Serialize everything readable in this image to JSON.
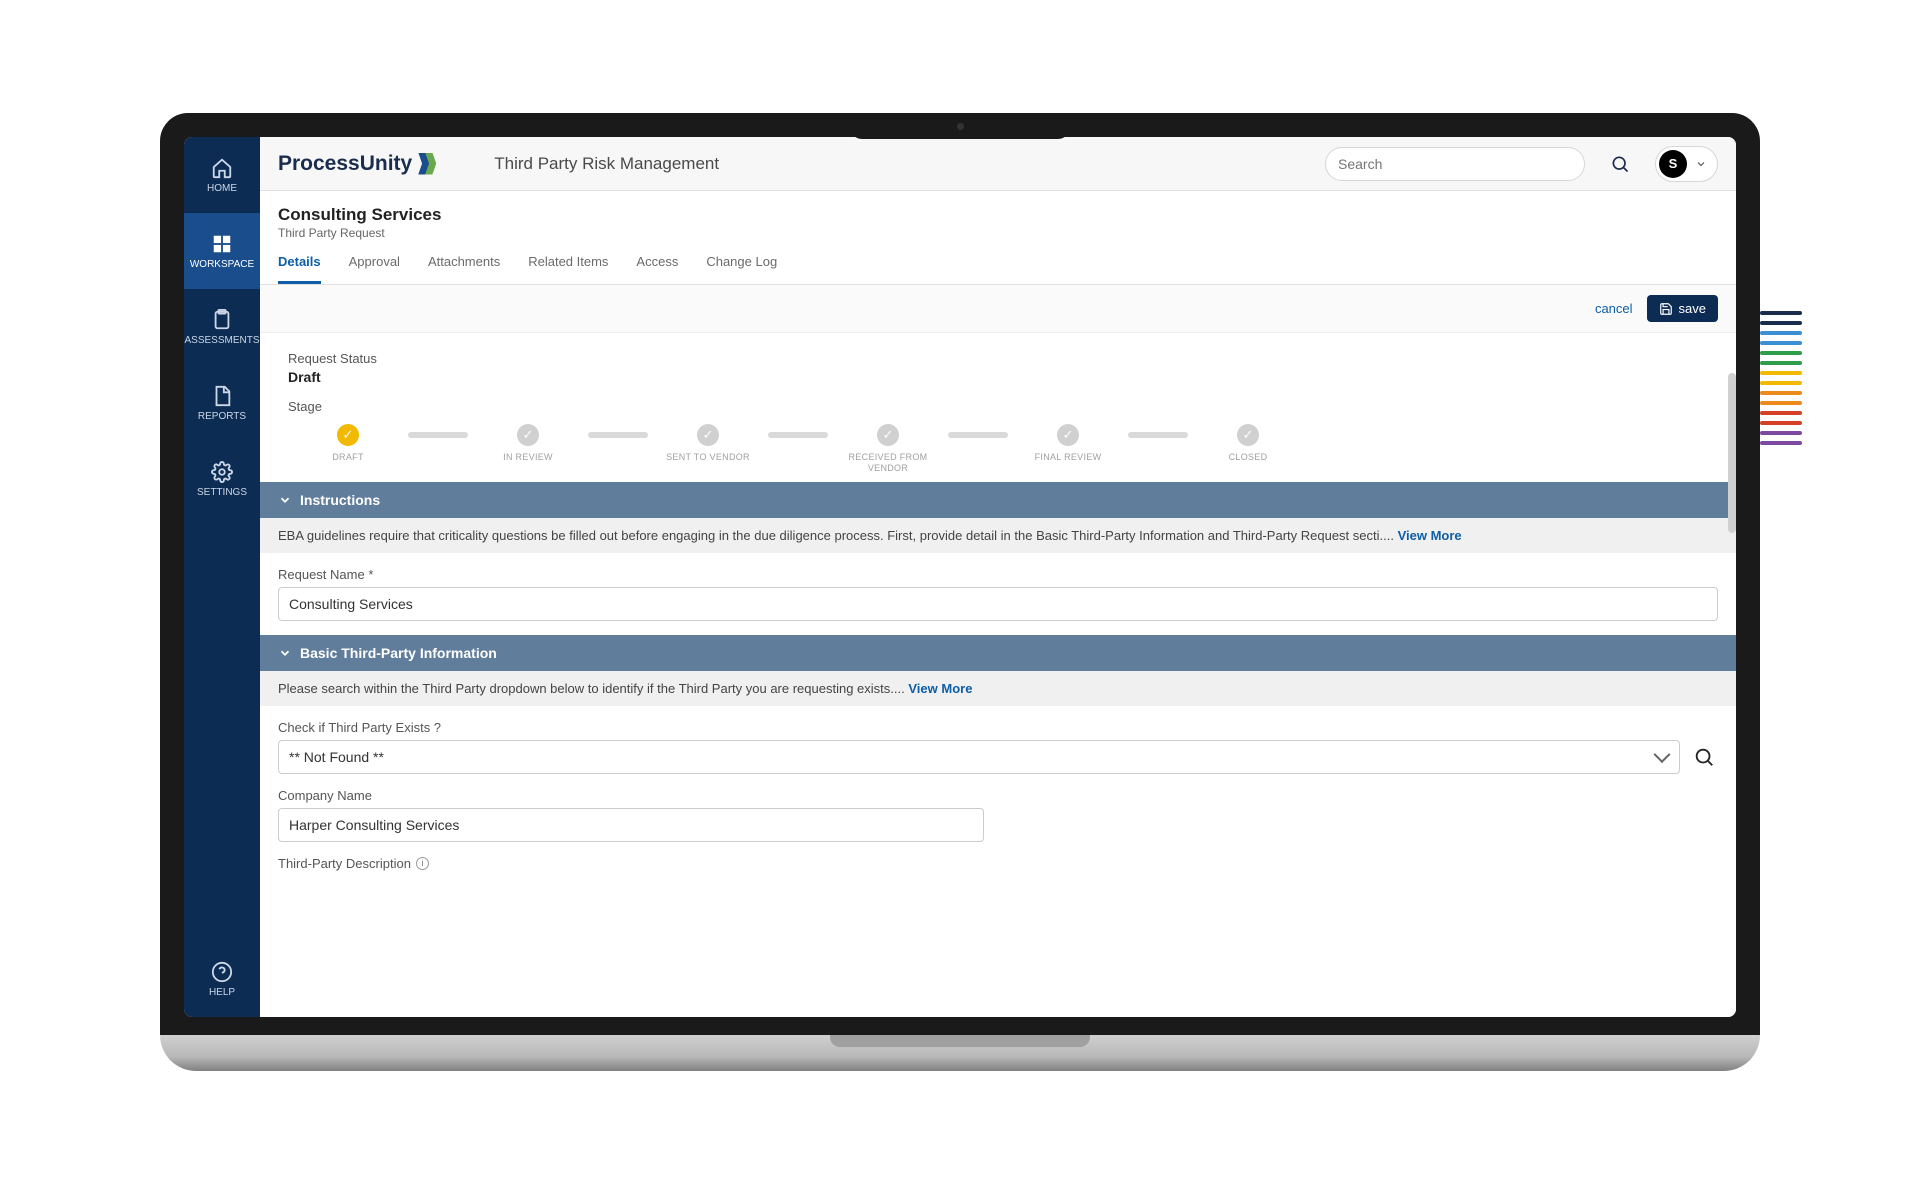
{
  "brand": {
    "name": "ProcessUnity"
  },
  "appTitle": "Third Party Risk Management",
  "search": {
    "placeholder": "Search"
  },
  "user": {
    "initial": "S"
  },
  "sidebar": {
    "items": [
      {
        "label": "HOME"
      },
      {
        "label": "WORKSPACE"
      },
      {
        "label": "ASSESSMENTS"
      },
      {
        "label": "REPORTS"
      },
      {
        "label": "SETTINGS"
      },
      {
        "label": "HELP"
      }
    ]
  },
  "page": {
    "title": "Consulting Services",
    "subtitle": "Third Party Request",
    "tabs": [
      "Details",
      "Approval",
      "Attachments",
      "Related Items",
      "Access",
      "Change Log"
    ],
    "activeTab": 0
  },
  "actions": {
    "cancel": "cancel",
    "save": "save"
  },
  "status": {
    "label": "Request Status",
    "value": "Draft",
    "stageLabel": "Stage",
    "stages": [
      "DRAFT",
      "IN REVIEW",
      "SENT TO VENDOR",
      "RECEIVED FROM VENDOR",
      "FINAL REVIEW",
      "CLOSED"
    ],
    "activeStage": 0
  },
  "sections": {
    "instructions": {
      "title": "Instructions",
      "hint": "EBA guidelines require that criticality questions be filled out before engaging in the due diligence process. First, provide detail in the Basic Third-Party Information and Third-Party Request secti....",
      "viewMore": "View More",
      "requestNameLabel": "Request Name *",
      "requestNameValue": "Consulting Services"
    },
    "basic": {
      "title": "Basic Third-Party Information",
      "hint": "Please search within the Third Party dropdown below to identify if the Third Party you are requesting exists....",
      "viewMore": "View More",
      "checkLabel": "Check if Third Party Exists ?",
      "checkValue": "** Not Found **",
      "companyLabel": "Company Name",
      "companyValue": "Harper Consulting Services",
      "descLabel": "Third-Party Description"
    }
  }
}
